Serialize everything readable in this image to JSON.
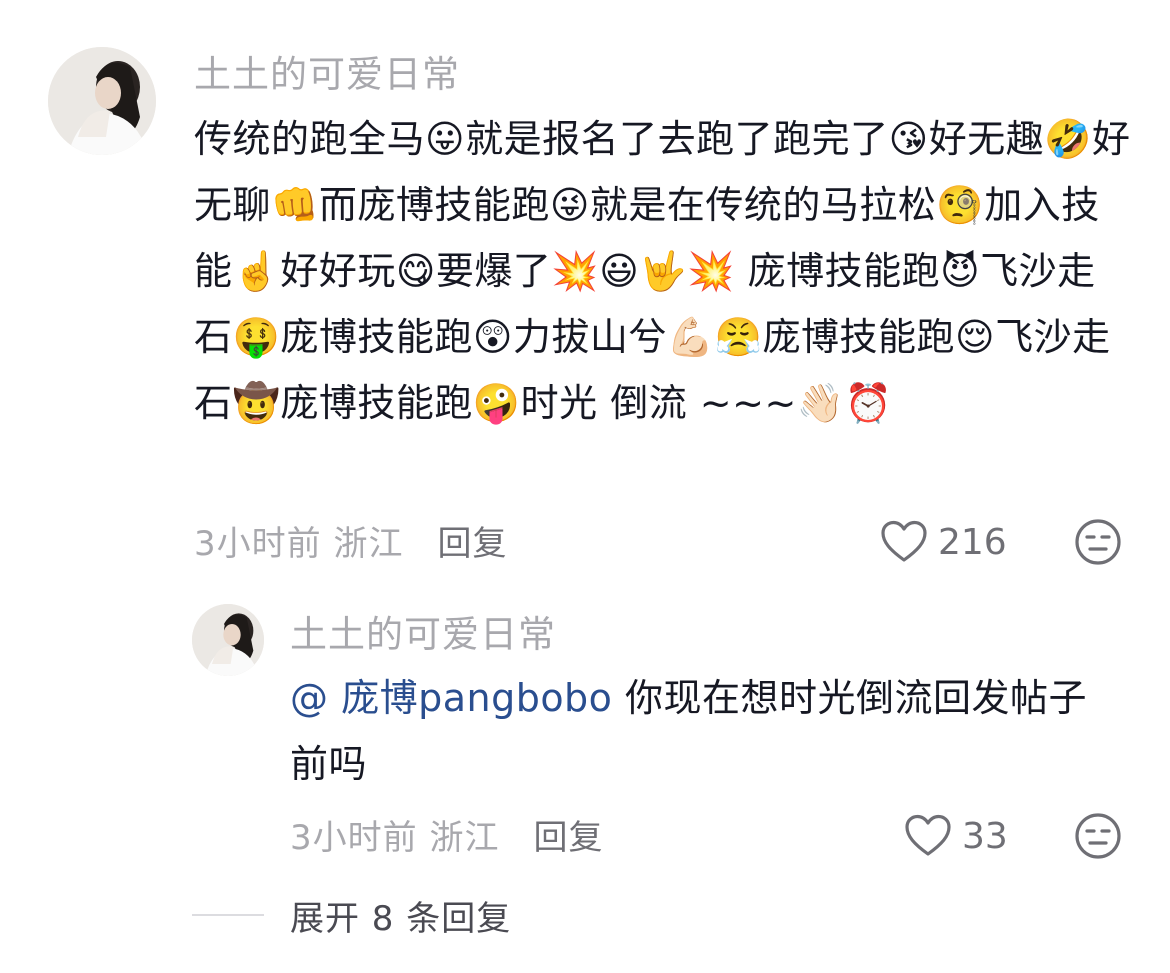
{
  "comment": {
    "username": "土土的可爱日常",
    "text": "传统的跑全马😛就是报名了去跑了跑完了😘好无趣🤣好无聊👊而庞博技能跑😜就是在传统的马拉松🧐加入技能☝️好好玩😋要爆了💥😃🤟💥 庞博技能跑😈飞沙走石🤑庞博技能跑😲力拔山兮💪🏻😤庞博技能跑😌飞沙走石🤠庞博技能跑🤪时光 倒流 ~~~👋🏻⏰",
    "time_location": "3小时前 浙江",
    "reply_label": "回复",
    "like_count": "216"
  },
  "reply": {
    "username": "土土的可爱日常",
    "mention": "@ 庞博pangbobo",
    "text": " 你现在想时光倒流回发帖子前吗",
    "time_location": "3小时前 浙江",
    "reply_label": "回复",
    "like_count": "33"
  },
  "expand_label": "展开 8 条回复",
  "icons": {
    "like": "heart-outline-icon",
    "dislike": "neutral-face-icon"
  },
  "colors": {
    "username": "#a8a8ad",
    "text": "#161823",
    "mention": "#2a4e8f",
    "meta": "#a8a8ad"
  }
}
